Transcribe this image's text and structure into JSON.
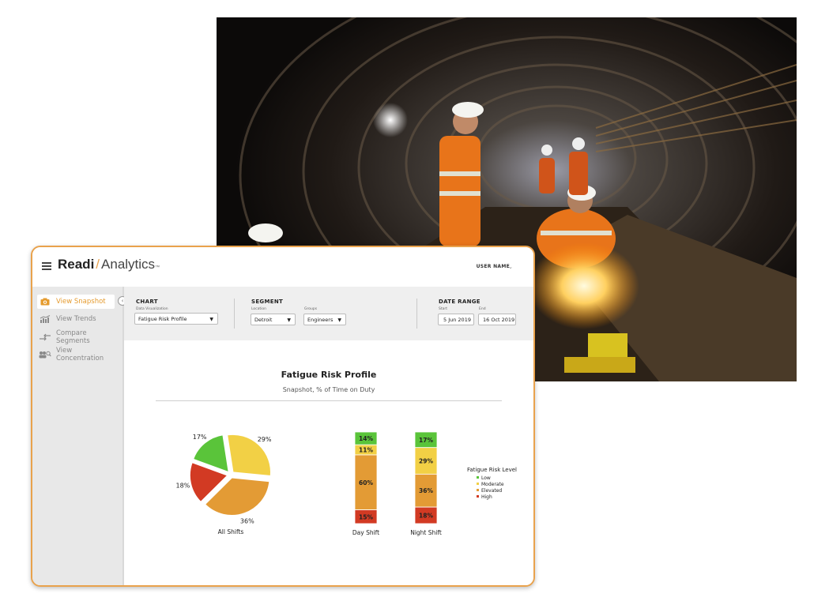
{
  "photo": {
    "description_icon": "tunnel-workers-photo"
  },
  "app": {
    "brand_part1": "Readi",
    "brand_slash": "/",
    "brand_part2": "Analytics",
    "brand_tm": "™",
    "user_name": "USER NAME"
  },
  "sidebar": {
    "items": [
      {
        "label": "View Snapshot",
        "icon": "camera-icon",
        "active": true
      },
      {
        "label": "View Trends",
        "icon": "trend-chart-icon",
        "active": false
      },
      {
        "label": "Compare Segments",
        "icon": "compare-arrows-icon",
        "active": false
      },
      {
        "label": "View Concentration",
        "icon": "people-search-icon",
        "active": false
      }
    ]
  },
  "filters": {
    "chart": {
      "title": "CHART",
      "sub_label": "Data Visualization",
      "value": "Fatigue Risk Profile"
    },
    "segment": {
      "title": "SEGMENT",
      "location_label": "Location",
      "location_value": "Detroit",
      "groups_label": "Groups",
      "groups_value": "Engineers"
    },
    "date_range": {
      "title": "DATE RANGE",
      "start_label": "Start",
      "start_value": "5 Jun 2019",
      "end_label": "End",
      "end_value": "16 Oct 2019"
    }
  },
  "colors": {
    "accent": "#e9a24c",
    "low": "#5ac43a",
    "moderate": "#f2d045",
    "elevated": "#e39b35",
    "high": "#d23a23"
  },
  "chart_data": {
    "title": "Fatigue Risk Profile",
    "subtitle": "Snapshot, % of Time on Duty",
    "legend_title": "Fatigue Risk Level",
    "levels": [
      "Low",
      "Moderate",
      "Elevated",
      "High"
    ],
    "pie": {
      "type": "pie",
      "label": "All Shifts",
      "values": [
        17,
        29,
        36,
        18
      ]
    },
    "stacked": {
      "type": "bar",
      "categories": [
        "Day Shift",
        "Night Shift"
      ],
      "series": [
        {
          "name": "Low",
          "values": [
            14,
            17
          ]
        },
        {
          "name": "Moderate",
          "values": [
            11,
            29
          ]
        },
        {
          "name": "Elevated",
          "values": [
            60,
            36
          ]
        },
        {
          "name": "High",
          "values": [
            15,
            18
          ]
        }
      ]
    }
  }
}
